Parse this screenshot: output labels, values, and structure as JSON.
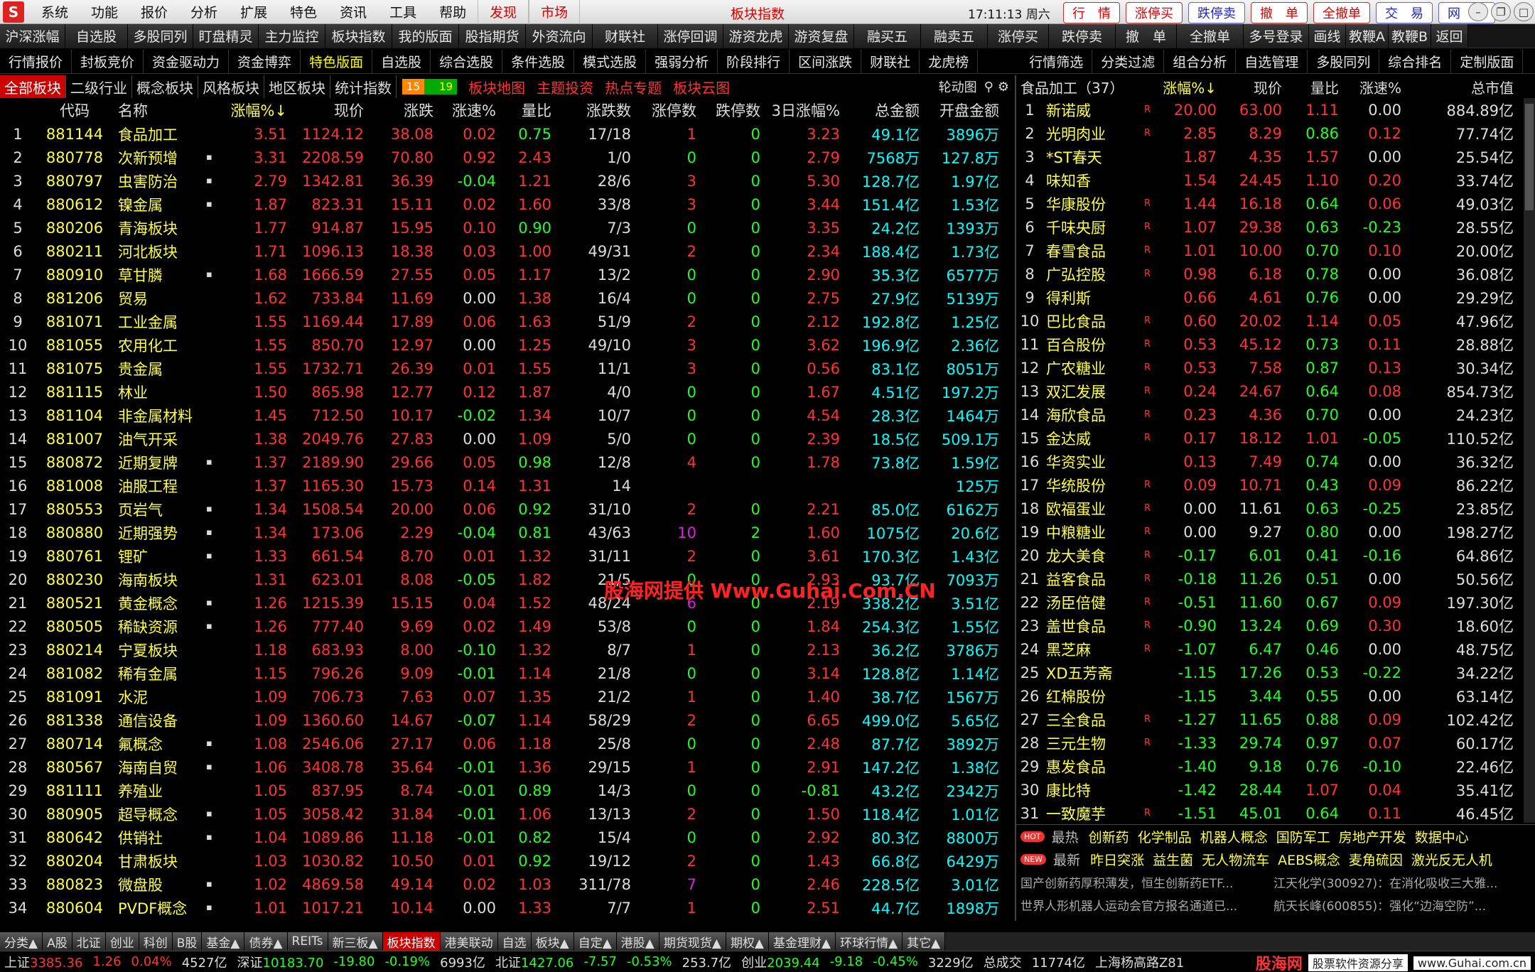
{
  "menu": {
    "logo": "S",
    "items": [
      "系统",
      "功能",
      "报价",
      "分析",
      "扩展",
      "特色",
      "资讯",
      "工具",
      "帮助"
    ],
    "red_items": [
      "发现",
      "市场"
    ],
    "window_title": "板块指数",
    "clock": "17:11:13 周六",
    "trade_buttons": [
      "行　情",
      "涨停买",
      "跌停卖",
      "撤　单",
      "全撤单",
      "交　易",
      "网　站"
    ]
  },
  "toolbar1": [
    "沪深涨幅",
    "自选股",
    "多股同列",
    "盯盘精灵",
    "主力监控",
    "板块指数",
    "我的版面",
    "股指期货",
    "外资流向",
    "财联社",
    "涨停回调",
    "游资龙虎",
    "游资复盘",
    "融买五",
    "融卖五",
    "涨停买",
    "跌停卖",
    "撤　单",
    "全撤单",
    "多号登录",
    "画线",
    "教鞭A",
    "教鞭B",
    "返回"
  ],
  "toolbar2": [
    "行情报价",
    "封板竞价",
    "资金驱动力",
    "资金博弈",
    "特色版面",
    "自选股",
    "综合选股",
    "条件选股",
    "模式选股",
    "强弱分析",
    "阶段排行",
    "区间涨跌",
    "财联社",
    "龙虎榜",
    "行情筛选",
    "分类过滤",
    "组合分析",
    "自选管理",
    "多股同列",
    "综合排名",
    "定制版面"
  ],
  "board_tabs": [
    "全部板块",
    "二级行业",
    "概念板块",
    "风格板块",
    "地区板块",
    "统计指数"
  ],
  "count_up": "15",
  "count_down": "19",
  "red_tabs": [
    "板块地图",
    "主题投资",
    "热点专题",
    "板块云图"
  ],
  "lunbo": "轮动图",
  "left_headers": [
    "",
    "代码",
    "名称",
    "",
    "涨幅%↓",
    "现价",
    "涨跌",
    "涨速%",
    "量比",
    "涨跌数",
    "涨停数",
    "跌停数",
    "3日涨幅%",
    "总金额",
    "开盘金额"
  ],
  "left_rows": [
    [
      "1",
      "881144",
      "食品加工",
      "",
      "3.51",
      "1124.12",
      "38.08",
      "0.02",
      "0.75",
      "17/18",
      "1",
      "0",
      "3.23",
      "49.1亿",
      "3896万"
    ],
    [
      "2",
      "880778",
      "次新预增",
      "▪",
      "3.31",
      "2208.59",
      "70.80",
      "0.92",
      "2.43",
      "1/0",
      "0",
      "0",
      "2.79",
      "7568万",
      "127.8万"
    ],
    [
      "3",
      "880797",
      "虫害防治",
      "▪",
      "2.79",
      "1342.81",
      "36.39",
      "-0.04",
      "1.21",
      "28/6",
      "3",
      "0",
      "5.30",
      "128.7亿",
      "1.97亿"
    ],
    [
      "4",
      "880612",
      "镍金属",
      "▪",
      "1.87",
      "823.31",
      "15.11",
      "0.02",
      "1.60",
      "33/8",
      "3",
      "0",
      "3.44",
      "151.4亿",
      "1.53亿"
    ],
    [
      "5",
      "880206",
      "青海板块",
      "",
      "1.77",
      "914.87",
      "15.95",
      "0.10",
      "0.90",
      "7/3",
      "0",
      "0",
      "3.35",
      "24.2亿",
      "1393万"
    ],
    [
      "6",
      "880211",
      "河北板块",
      "",
      "1.71",
      "1096.13",
      "18.38",
      "0.03",
      "1.00",
      "49/31",
      "2",
      "0",
      "2.34",
      "188.4亿",
      "1.73亿"
    ],
    [
      "7",
      "880910",
      "草甘膦",
      "▪",
      "1.68",
      "1666.59",
      "27.55",
      "0.05",
      "1.17",
      "13/2",
      "0",
      "0",
      "2.90",
      "35.3亿",
      "6577万"
    ],
    [
      "8",
      "881206",
      "贸易",
      "",
      "1.62",
      "733.84",
      "11.69",
      "0.00",
      "1.38",
      "16/4",
      "0",
      "0",
      "2.75",
      "27.9亿",
      "5139万"
    ],
    [
      "9",
      "881071",
      "工业金属",
      "",
      "1.55",
      "1169.44",
      "17.89",
      "0.06",
      "1.63",
      "51/9",
      "2",
      "0",
      "2.12",
      "192.8亿",
      "1.25亿"
    ],
    [
      "10",
      "881055",
      "农用化工",
      "",
      "1.55",
      "850.70",
      "12.97",
      "0.00",
      "1.25",
      "49/10",
      "3",
      "0",
      "3.62",
      "196.9亿",
      "2.36亿"
    ],
    [
      "11",
      "881075",
      "贵金属",
      "",
      "1.55",
      "1732.71",
      "26.39",
      "0.01",
      "1.55",
      "11/1",
      "3",
      "0",
      "0.56",
      "83.1亿",
      "8051万"
    ],
    [
      "12",
      "881115",
      "林业",
      "",
      "1.50",
      "865.98",
      "12.77",
      "0.12",
      "1.87",
      "4/0",
      "0",
      "0",
      "1.67",
      "4.51亿",
      "197.2万"
    ],
    [
      "13",
      "881104",
      "非金属材料",
      "",
      "1.45",
      "712.50",
      "10.17",
      "-0.02",
      "1.34",
      "10/7",
      "0",
      "0",
      "4.54",
      "28.3亿",
      "1464万"
    ],
    [
      "14",
      "881007",
      "油气开采",
      "",
      "1.38",
      "2049.76",
      "27.83",
      "0.00",
      "1.09",
      "5/0",
      "0",
      "0",
      "2.39",
      "18.5亿",
      "509.1万"
    ],
    [
      "15",
      "880872",
      "近期复牌",
      "▪",
      "1.37",
      "2189.90",
      "29.66",
      "0.05",
      "0.98",
      "12/8",
      "4",
      "0",
      "1.78",
      "73.8亿",
      "1.59亿"
    ],
    [
      "16",
      "881008",
      "油服工程",
      "",
      "1.37",
      "1165.30",
      "15.73",
      "0.14",
      "1.31",
      "14",
      "",
      "",
      "",
      "",
      "125万"
    ],
    [
      "17",
      "880553",
      "页岩气",
      "▪",
      "1.34",
      "1508.54",
      "20.00",
      "0.06",
      "0.92",
      "31/10",
      "2",
      "0",
      "2.21",
      "85.0亿",
      "6162万"
    ],
    [
      "18",
      "880880",
      "近期强势",
      "▪",
      "1.34",
      "173.06",
      "2.29",
      "-0.04",
      "0.81",
      "43/63",
      "10",
      "2",
      "1.60",
      "1075亿",
      "20.6亿"
    ],
    [
      "19",
      "880761",
      "锂矿",
      "▪",
      "1.33",
      "661.54",
      "8.70",
      "0.01",
      "1.32",
      "31/11",
      "2",
      "0",
      "3.61",
      "170.3亿",
      "1.43亿"
    ],
    [
      "20",
      "880230",
      "海南板块",
      "",
      "1.31",
      "623.01",
      "8.08",
      "-0.05",
      "1.82",
      "21/5",
      "0",
      "0",
      "2.93",
      "93.7亿",
      "7093万"
    ],
    [
      "21",
      "880521",
      "黄金概念",
      "▪",
      "1.26",
      "1215.39",
      "15.15",
      "0.04",
      "1.52",
      "48/24",
      "6",
      "0",
      "2.19",
      "338.2亿",
      "3.51亿"
    ],
    [
      "22",
      "880505",
      "稀缺资源",
      "▪",
      "1.26",
      "777.40",
      "9.69",
      "0.02",
      "1.49",
      "53/8",
      "0",
      "0",
      "1.84",
      "254.3亿",
      "1.55亿"
    ],
    [
      "23",
      "880214",
      "宁夏板块",
      "",
      "1.18",
      "683.93",
      "8.00",
      "-0.10",
      "1.32",
      "8/7",
      "1",
      "0",
      "2.13",
      "36.2亿",
      "3786万"
    ],
    [
      "24",
      "881082",
      "稀有金属",
      "",
      "1.15",
      "796.26",
      "9.09",
      "-0.01",
      "1.14",
      "21/8",
      "0",
      "0",
      "3.14",
      "128.8亿",
      "1.14亿"
    ],
    [
      "25",
      "881091",
      "水泥",
      "",
      "1.09",
      "706.73",
      "7.63",
      "0.07",
      "1.35",
      "21/2",
      "1",
      "0",
      "1.40",
      "38.7亿",
      "1567万"
    ],
    [
      "26",
      "881338",
      "通信设备",
      "",
      "1.09",
      "1360.60",
      "14.67",
      "-0.07",
      "1.14",
      "58/29",
      "2",
      "0",
      "6.65",
      "499.0亿",
      "5.65亿"
    ],
    [
      "27",
      "880714",
      "氟概念",
      "▪",
      "1.08",
      "2546.06",
      "27.17",
      "0.06",
      "1.18",
      "25/8",
      "0",
      "0",
      "2.48",
      "87.7亿",
      "3892万"
    ],
    [
      "28",
      "880567",
      "海南自贸",
      "▪",
      "1.06",
      "3408.78",
      "35.64",
      "-0.01",
      "1.36",
      "29/15",
      "1",
      "0",
      "2.91",
      "147.2亿",
      "1.38亿"
    ],
    [
      "29",
      "881111",
      "养殖业",
      "",
      "1.05",
      "837.95",
      "8.74",
      "-0.01",
      "0.89",
      "14/3",
      "0",
      "0",
      "-0.81",
      "43.2亿",
      "2342万"
    ],
    [
      "30",
      "880905",
      "超导概念",
      "▪",
      "1.05",
      "3058.42",
      "31.84",
      "-0.01",
      "1.06",
      "13/13",
      "2",
      "0",
      "1.50",
      "118.4亿",
      "1.01亿"
    ],
    [
      "31",
      "880642",
      "供销社",
      "▪",
      "1.04",
      "1089.86",
      "11.18",
      "-0.01",
      "0.82",
      "15/4",
      "0",
      "0",
      "2.92",
      "80.3亿",
      "8800万"
    ],
    [
      "32",
      "880204",
      "甘肃板块",
      "",
      "1.03",
      "1030.82",
      "10.50",
      "0.01",
      "0.92",
      "19/12",
      "2",
      "0",
      "1.43",
      "66.8亿",
      "6429万"
    ],
    [
      "33",
      "880823",
      "微盘股",
      "▪",
      "1.02",
      "4869.58",
      "49.14",
      "0.02",
      "1.03",
      "311/78",
      "7",
      "0",
      "2.46",
      "228.5亿",
      "3.01亿"
    ],
    [
      "34",
      "880604",
      "PVDF概念",
      "▪",
      "1.01",
      "1017.21",
      "10.14",
      "0.00",
      "1.33",
      "7/7",
      "1",
      "0",
      "2.51",
      "44.7亿",
      "1898万"
    ]
  ],
  "red_dot_rows": [
    27,
    30
  ],
  "watermark": "股海网提供 Www.Guhai.Com.CN",
  "right_title": "食品加工（37）",
  "right_headers": [
    "",
    "",
    "",
    "涨幅%↓",
    "现价",
    "量比",
    "涨速%",
    "总市值"
  ],
  "right_rows": [
    [
      "1",
      "新诺威",
      "R",
      "20.00",
      "63.00",
      "1.11",
      "0.00",
      "884.89亿"
    ],
    [
      "2",
      "光明肉业",
      "R",
      "2.85",
      "8.29",
      "0.86",
      "0.12",
      "77.74亿"
    ],
    [
      "3",
      "*ST春天",
      "",
      "1.87",
      "4.35",
      "1.57",
      "0.00",
      "25.54亿"
    ],
    [
      "4",
      "味知香",
      "",
      "1.54",
      "24.45",
      "1.10",
      "0.20",
      "33.74亿"
    ],
    [
      "5",
      "华康股份",
      "R",
      "1.44",
      "16.18",
      "0.64",
      "0.06",
      "49.03亿"
    ],
    [
      "6",
      "千味央厨",
      "R",
      "1.07",
      "29.38",
      "0.63",
      "-0.23",
      "28.55亿"
    ],
    [
      "7",
      "春雪食品",
      "R",
      "1.01",
      "10.00",
      "0.70",
      "0.10",
      "20.00亿"
    ],
    [
      "8",
      "广弘控股",
      "R",
      "0.98",
      "6.18",
      "0.78",
      "0.00",
      "36.08亿"
    ],
    [
      "9",
      "得利斯",
      "",
      "0.66",
      "4.61",
      "0.76",
      "0.00",
      "29.29亿"
    ],
    [
      "10",
      "巴比食品",
      "R",
      "0.60",
      "20.02",
      "1.14",
      "0.05",
      "47.96亿"
    ],
    [
      "11",
      "百合股份",
      "R",
      "0.53",
      "45.12",
      "0.73",
      "0.11",
      "28.88亿"
    ],
    [
      "12",
      "广农糖业",
      "R",
      "0.53",
      "7.58",
      "0.87",
      "0.13",
      "30.34亿"
    ],
    [
      "13",
      "双汇发展",
      "R",
      "0.24",
      "24.67",
      "0.64",
      "0.08",
      "854.73亿"
    ],
    [
      "14",
      "海欣食品",
      "R",
      "0.23",
      "4.36",
      "0.70",
      "0.00",
      "24.23亿"
    ],
    [
      "15",
      "金达威",
      "R",
      "0.17",
      "18.12",
      "1.01",
      "-0.05",
      "110.52亿"
    ],
    [
      "16",
      "华资实业",
      "",
      "0.13",
      "7.49",
      "0.74",
      "0.00",
      "36.32亿"
    ],
    [
      "17",
      "华统股份",
      "R",
      "0.09",
      "10.71",
      "0.43",
      "0.09",
      "86.22亿"
    ],
    [
      "18",
      "欧福蛋业",
      "R",
      "0.00",
      "11.61",
      "0.63",
      "-0.25",
      "23.85亿"
    ],
    [
      "19",
      "中粮糖业",
      "R",
      "0.00",
      "9.27",
      "0.80",
      "0.00",
      "198.27亿"
    ],
    [
      "20",
      "龙大美食",
      "R",
      "-0.17",
      "6.01",
      "0.41",
      "-0.16",
      "64.86亿"
    ],
    [
      "21",
      "益客食品",
      "R",
      "-0.18",
      "11.26",
      "0.51",
      "0.00",
      "50.56亿"
    ],
    [
      "22",
      "汤臣倍健",
      "R",
      "-0.51",
      "11.60",
      "0.67",
      "0.09",
      "197.30亿"
    ],
    [
      "23",
      "盖世食品",
      "R",
      "-0.90",
      "13.24",
      "0.69",
      "0.30",
      "18.60亿"
    ],
    [
      "24",
      "黑芝麻",
      "R",
      "-1.07",
      "6.47",
      "0.46",
      "0.00",
      "48.75亿"
    ],
    [
      "25",
      "XD五芳斋",
      "",
      "-1.15",
      "17.26",
      "0.53",
      "-0.22",
      "34.22亿"
    ],
    [
      "26",
      "红棉股份",
      "",
      "-1.15",
      "3.44",
      "0.55",
      "0.00",
      "63.14亿"
    ],
    [
      "27",
      "三全食品",
      "R",
      "-1.27",
      "11.65",
      "0.88",
      "0.09",
      "102.42亿"
    ],
    [
      "28",
      "三元生物",
      "R",
      "-1.33",
      "29.74",
      "0.97",
      "0.07",
      "60.17亿"
    ],
    [
      "29",
      "惠发食品",
      "",
      "-1.40",
      "9.18",
      "0.76",
      "-0.10",
      "22.46亿"
    ],
    [
      "30",
      "康比特",
      "",
      "-1.42",
      "28.44",
      "1.07",
      "0.04",
      "35.41亿"
    ],
    [
      "31",
      "一致魔芋",
      "R",
      "-1.51",
      "45.01",
      "0.64",
      "0.11",
      "46.45亿"
    ]
  ],
  "news": {
    "hot_badge": "HOT",
    "hot_label": "最热",
    "hot_tags": [
      "创新药",
      "化学制品",
      "机器人概念",
      "国防军工",
      "房地产开发",
      "数据中心"
    ],
    "new_badge": "NEW",
    "new_label": "最新",
    "new_tags": [
      "昨日突涨",
      "益生菌",
      "无人物流车",
      "AEBS概念",
      "麦角硫因",
      "激光反无人机"
    ],
    "lines": [
      [
        "国产创新药厚积薄发，恒生创新药ETF...",
        "江天化学(300927)：在消化吸收三大雅..."
      ],
      [
        "世界人形机器人运动会官方报名通道已...",
        "航天长峰(600855)：强化“边海空防”..."
      ]
    ]
  },
  "bottom_tabs": [
    "分类▲",
    "A股",
    "北证",
    "创业",
    "科创",
    "B股",
    "基金▲",
    "债券▲",
    "REITs",
    "新三板▲",
    "板块指数",
    "港美联动",
    "自选",
    "板块▲",
    "自定▲",
    "港股▲",
    "期货现货▲",
    "期权▲",
    "基金理财▲",
    "环球行情▲",
    "其它▲"
  ],
  "status": {
    "sh_name": "上证",
    "sh_val": "3385.36",
    "sh_chg": "1.26",
    "sh_pct": "0.04%",
    "sh_amt": "4527亿",
    "sz_name": "深证",
    "sz_val": "10183.70",
    "sz_chg": "-19.80",
    "sz_pct": "-0.19%",
    "sz_amt": "6993亿",
    "bz_name": "北证",
    "bz_val": "1427.06",
    "bz_chg": "-7.57",
    "bz_pct": "-0.53%",
    "bz_amt": "253.7亿",
    "cy_name": "创业",
    "cy_val": "2039.44",
    "cy_chg": "-9.18",
    "cy_pct": "-0.45%",
    "cy_amt": "3229亿",
    "deal_label": "总成交",
    "deal_val": "11774亿",
    "server": "上海杨高路Z81",
    "brand_logo": "股海网",
    "brand_text": "股票软件资源分享",
    "brand_url": "www.Guhai.com.cn"
  }
}
